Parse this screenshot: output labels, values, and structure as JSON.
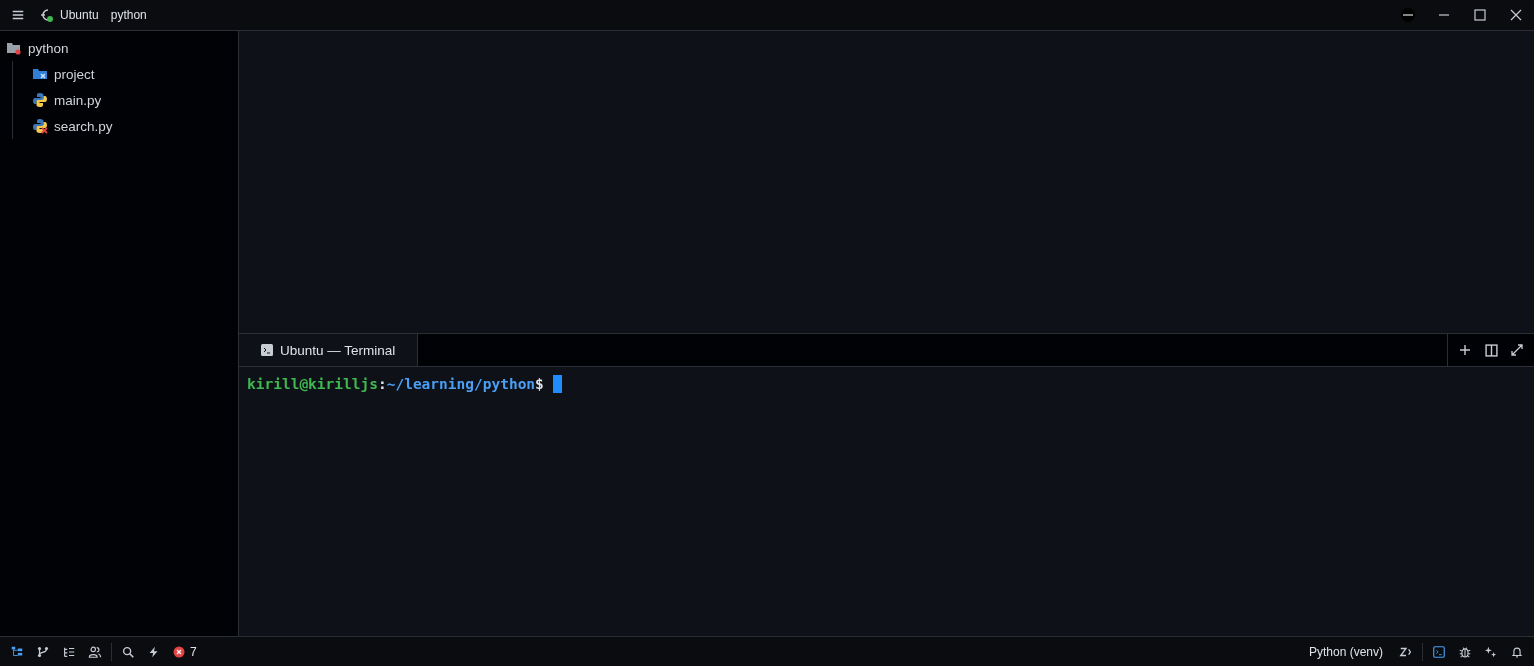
{
  "title_bar": {
    "host": "Ubuntu",
    "project": "python"
  },
  "file_tree": {
    "name": "python",
    "kind": "root-folder",
    "children": [
      {
        "name": "project",
        "kind": "folder"
      },
      {
        "name": "main.py",
        "kind": "python"
      },
      {
        "name": "search.py",
        "kind": "python-error"
      }
    ]
  },
  "terminal": {
    "tabs": [
      {
        "label": "Ubuntu — Terminal",
        "selected": true
      }
    ],
    "prompt": {
      "user_host": "kirill@kirilljs",
      "separator": ":",
      "path": "~/learning/python",
      "symbol": "$"
    }
  },
  "status_bar": {
    "left": [
      {
        "kind": "project",
        "selected": true
      },
      {
        "kind": "git",
        "selected": false
      },
      {
        "kind": "outline",
        "selected": false
      },
      {
        "kind": "collab",
        "selected": false
      }
    ],
    "left2": [
      {
        "kind": "search",
        "selected": false
      },
      {
        "kind": "bolt",
        "selected": false
      }
    ],
    "errors": "7",
    "language": "Python (venv)",
    "right": [
      {
        "kind": "terminal",
        "selected": true
      },
      {
        "kind": "debug",
        "selected": false
      },
      {
        "kind": "ai",
        "selected": false
      },
      {
        "kind": "bell",
        "selected": false
      }
    ]
  }
}
